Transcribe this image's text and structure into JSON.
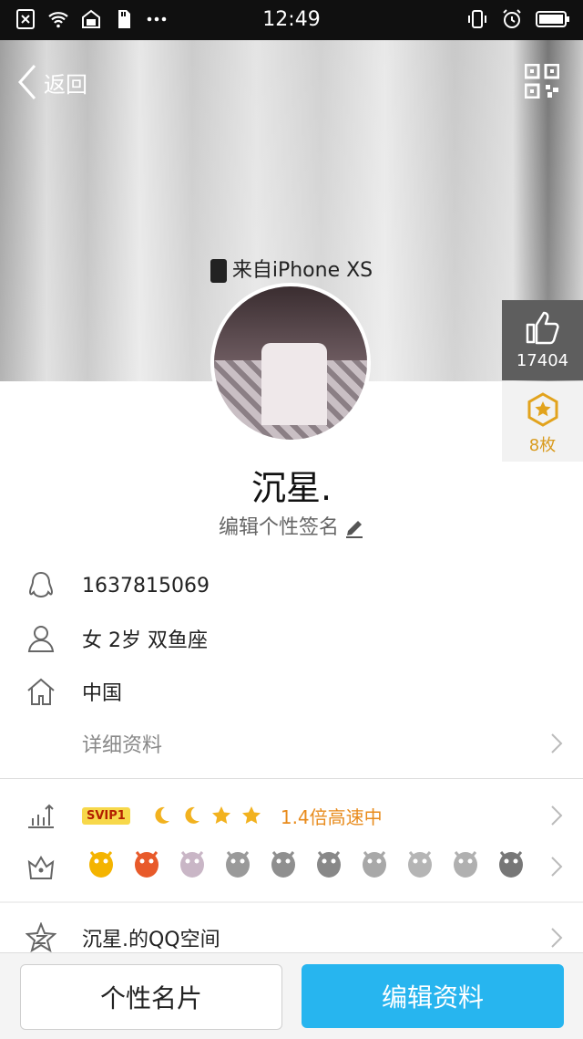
{
  "status_bar": {
    "time": "12:49",
    "left_icons": [
      "sim-off-icon",
      "wifi-icon",
      "storage-icon",
      "sd-card-icon",
      "more-dots-icon"
    ],
    "right_icons": [
      "vibrate-icon",
      "alarm-icon",
      "battery-icon"
    ]
  },
  "header": {
    "back_label": "返回",
    "qr_icon": "qr-code-icon"
  },
  "profile": {
    "device": "来自iPhone XS",
    "nickname": "沉星.",
    "signature": "编辑个性签名",
    "likes": "17404",
    "gifts": "8枚"
  },
  "info": {
    "qq_number": "1637815069",
    "gender_age": "女  2岁  双鱼座",
    "location": "中国",
    "details_label": "详细资料"
  },
  "vip": {
    "badge": "SVIP1",
    "speed": "1.4倍高速中"
  },
  "qzone": {
    "label": "沉星.的QQ空间"
  },
  "medals": [
    {
      "name": "qq-penguin-medal",
      "color": "#f4b400"
    },
    {
      "name": "lv1-lightning-medal",
      "color": "#e85a2a"
    },
    {
      "name": "heart-diamond-medal",
      "color": "#c9b6c6"
    },
    {
      "name": "gray-penguin-medal-1",
      "color": "#9a9a9a"
    },
    {
      "name": "gray-penguin-medal-2",
      "color": "#8f8f8f"
    },
    {
      "name": "gray-penguin-medal-3",
      "color": "#888888"
    },
    {
      "name": "vip1-medal",
      "color": "#a8a8a8"
    },
    {
      "name": "gray-diamond-medal",
      "color": "#b5b5b5"
    },
    {
      "name": "gray-star-medal",
      "color": "#b0b0b0"
    },
    {
      "name": "crown-penguin-medal",
      "color": "#777777"
    }
  ],
  "bottom": {
    "card_label": "个性名片",
    "edit_label": "编辑资料"
  },
  "colors": {
    "accent": "#27b5ef",
    "vip_orange": "#e88b1c",
    "like_bg": "#5e5e5e"
  }
}
